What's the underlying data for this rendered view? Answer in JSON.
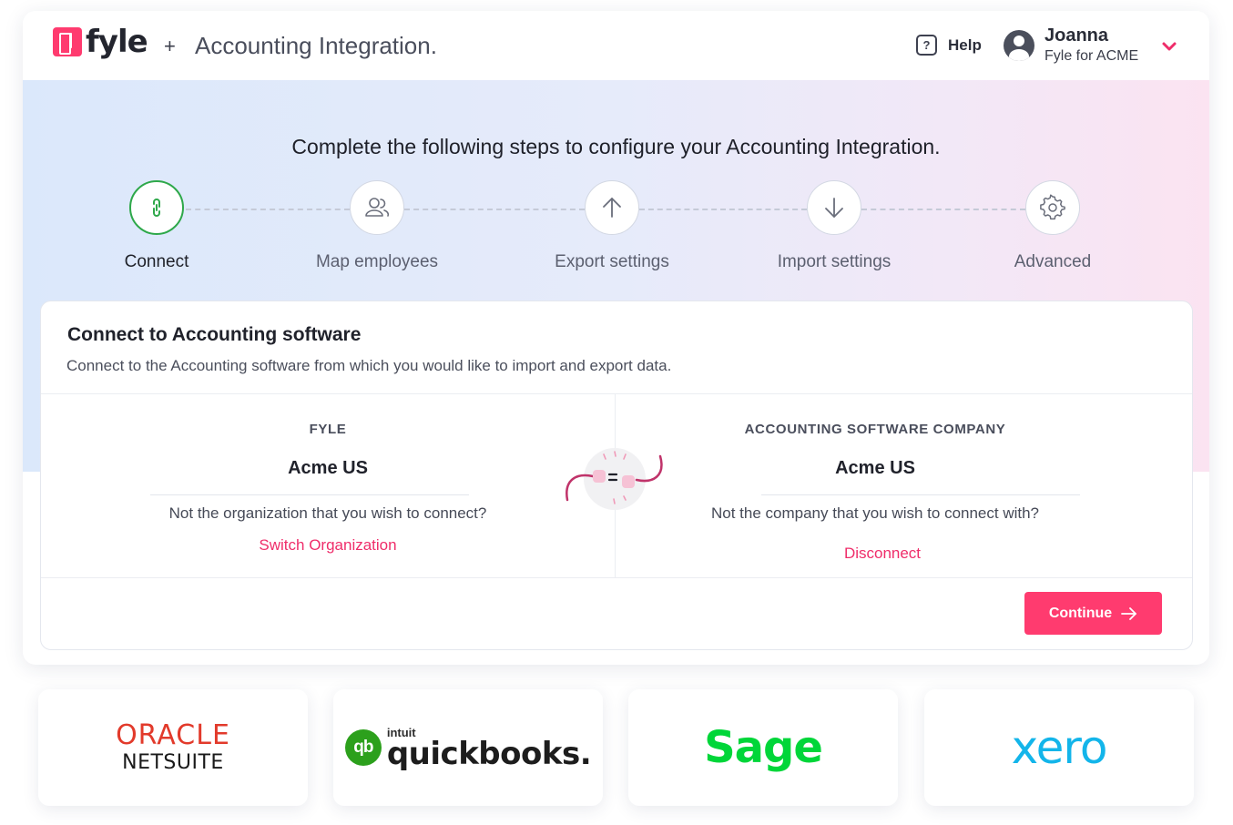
{
  "header": {
    "logo_text": "fyle",
    "plus": "+",
    "title": "Accounting Integration.",
    "help_icon_glyph": "?",
    "help_label": "Help",
    "user_name": "Joanna",
    "user_org": "Fyle for ACME"
  },
  "hero": {
    "heading": "Complete the following steps to configure your Accounting Integration."
  },
  "steps": [
    {
      "label": "Connect",
      "icon": "link-icon",
      "active": true
    },
    {
      "label": "Map employees",
      "icon": "users-icon",
      "active": false
    },
    {
      "label": "Export settings",
      "icon": "arrow-up-icon",
      "active": false
    },
    {
      "label": "Import settings",
      "icon": "arrow-down-icon",
      "active": false
    },
    {
      "label": "Advanced",
      "icon": "gear-icon",
      "active": false
    }
  ],
  "card": {
    "title": "Connect to Accounting software",
    "subtitle": "Connect to the Accounting software from which you would like to import and export data.",
    "fyle": {
      "label": "FYLE",
      "org": "Acme US",
      "question": "Not the organization that you wish to connect?",
      "link": "Switch Organization"
    },
    "accounting": {
      "label": "ACCOUNTING SOFTWARE COMPANY",
      "org": "Acme US",
      "question": "Not the company that you wish to connect with?",
      "link": "Disconnect"
    },
    "continue_label": "Continue"
  },
  "partners": {
    "oracle": "ORACLE",
    "netsuite": "NETSUITE",
    "qb_circle": "qb",
    "qb_intuit": "intuit",
    "qb_word": "quickbooks.",
    "sage": "Sage",
    "xero": "xero"
  },
  "colors": {
    "brand": "#ff3b6f",
    "active_step": "#2ea84a",
    "link": "#ef2d6a"
  }
}
